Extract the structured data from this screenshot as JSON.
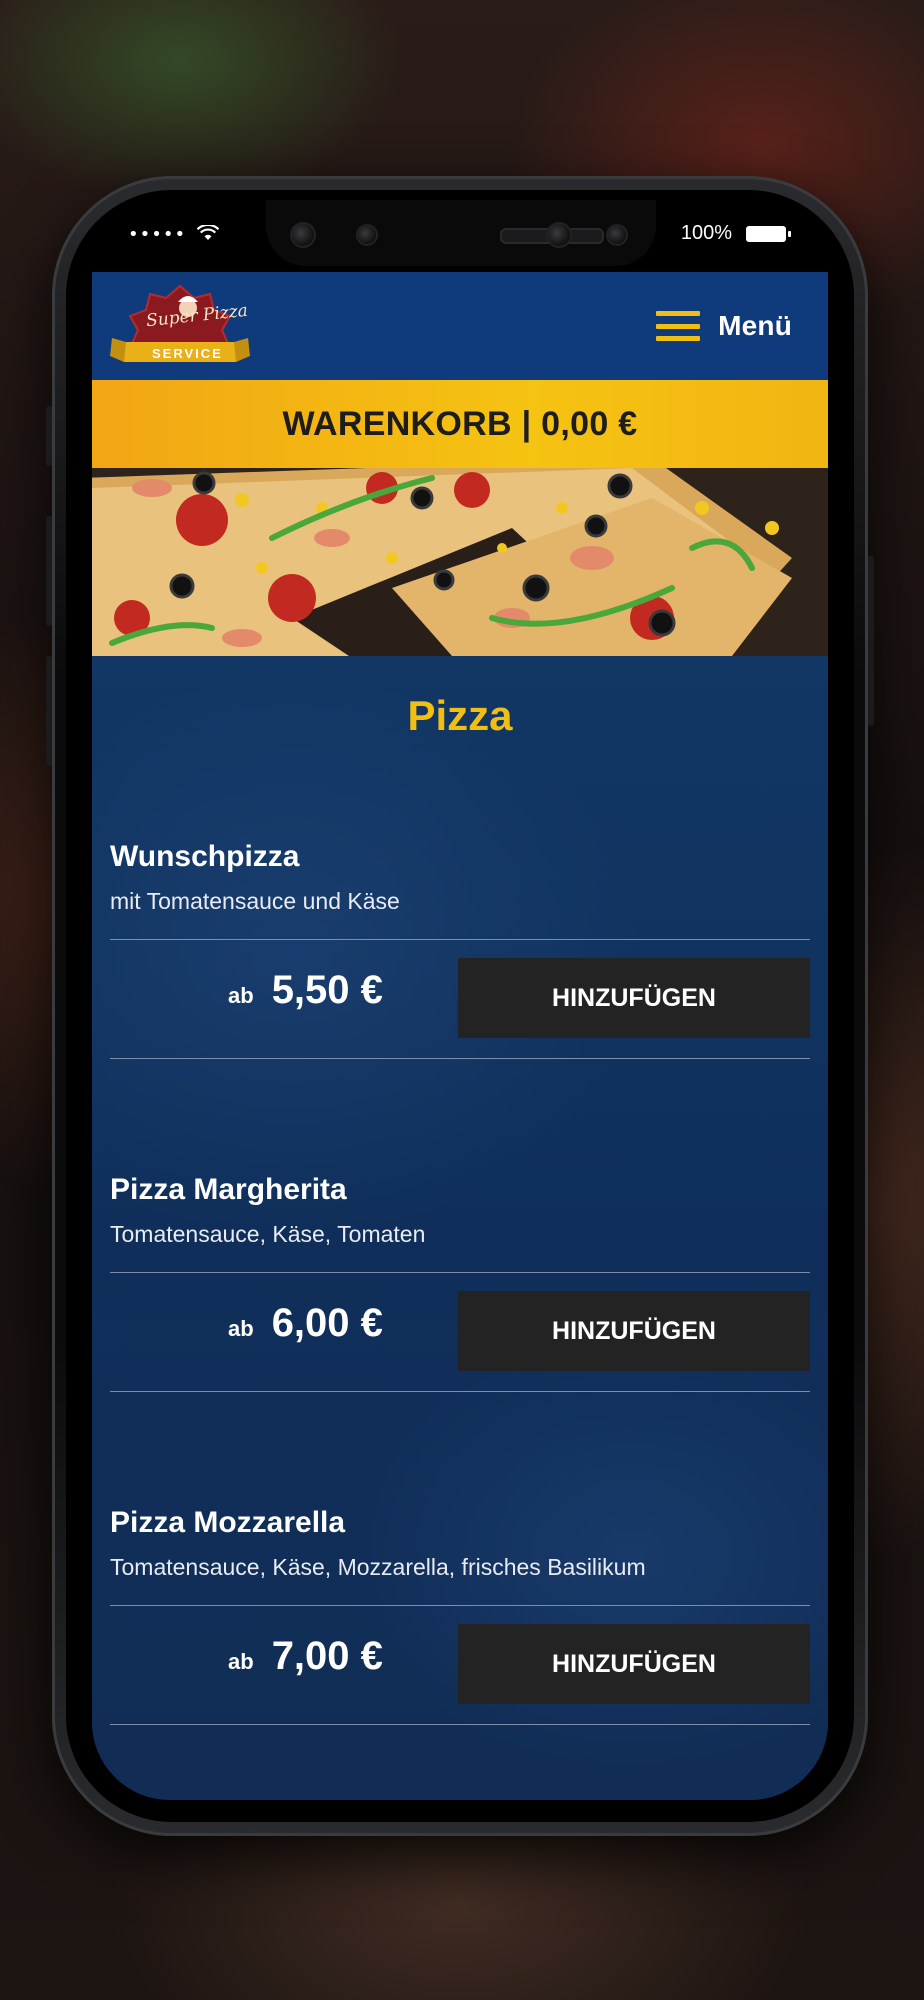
{
  "status_bar": {
    "signal": "•••••",
    "battery_text": "100%"
  },
  "header": {
    "logo_text": "Super Pizza",
    "logo_ribbon": "SERVICE",
    "menu_label": "Menü"
  },
  "cart": {
    "label": "WARENKORB | 0,00 €"
  },
  "section": {
    "title": "Pizza"
  },
  "items": [
    {
      "name": "Wunschpizza",
      "description": "mit Tomatensauce und Käse",
      "price_prefix": "ab",
      "price": "5,50 €",
      "button": "HINZUFÜGEN"
    },
    {
      "name": "Pizza Margherita",
      "description": "Tomatensauce, Käse, Tomaten",
      "price_prefix": "ab",
      "price": "6,00 €",
      "button": "HINZUFÜGEN"
    },
    {
      "name": "Pizza Mozzarella",
      "description": "Tomatensauce, Käse, Mozzarella, frisches Basilikum",
      "price_prefix": "ab",
      "price": "7,00 €",
      "button": "HINZUFÜGEN"
    }
  ],
  "colors": {
    "header_blue": "#0f3b7d",
    "accent_yellow": "#f0bf12",
    "button_dark": "#232324",
    "content_blue": "#123765"
  },
  "icons": [
    "wifi-icon",
    "battery-icon",
    "hamburger-menu-icon",
    "logo-chef-icon"
  ]
}
